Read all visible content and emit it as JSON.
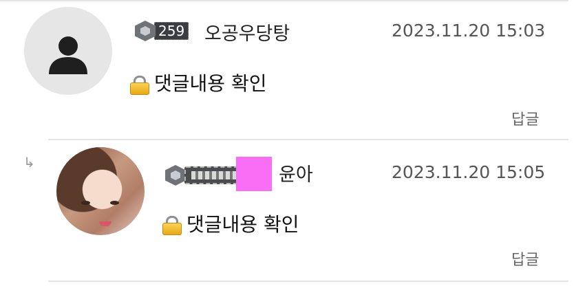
{
  "comments": [
    {
      "level": "259",
      "nickname": "오공우당탕",
      "timestamp": "2023.11.20 15:03",
      "content": "댓글내용 확인",
      "reply_label": "답글",
      "avatar": "default-person-icon"
    },
    {
      "nickname": "윤아",
      "timestamp": "2023.11.20 15:05",
      "content": "댓글내용 확인",
      "reply_label": "답글",
      "reply_arrow": "↳",
      "avatar": "profile-photo"
    }
  ],
  "colors": {
    "divider": "#e3e3e3",
    "pink_box": "#f86ef4",
    "timestamp": "#555555",
    "reply": "#666666"
  }
}
